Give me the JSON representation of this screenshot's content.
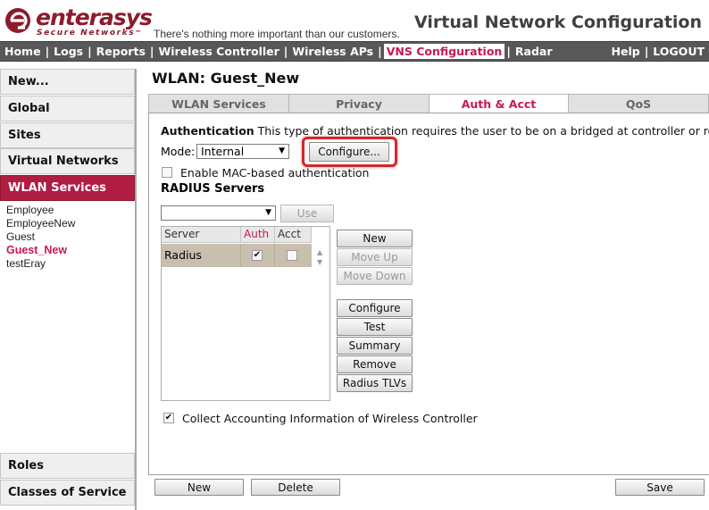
{
  "header": {
    "brand": "enterasys",
    "brand_sub": "Secure Networks",
    "brand_tm": "™",
    "tagline": "There's nothing more important than our customers.",
    "page_heading": "Virtual Network Configuration"
  },
  "nav": {
    "left": [
      "Home",
      "Logs",
      "Reports",
      "Wireless Controller",
      "Wireless APs",
      "VNS Configuration",
      "Radar"
    ],
    "active": "VNS Configuration",
    "help": "Help",
    "logout": "LOGOUT"
  },
  "sidebar": {
    "buttons": [
      "New...",
      "Global",
      "Sites",
      "Virtual Networks",
      "WLAN Services"
    ],
    "active_button": "WLAN Services",
    "wlan_list": [
      "Employee",
      "EmployeeNew",
      "Guest",
      "Guest_New",
      "testEray"
    ],
    "active_wlan": "Guest_New",
    "bottom_buttons": [
      "Roles",
      "Classes of Service"
    ]
  },
  "main": {
    "title": "WLAN: Guest_New",
    "tabs": [
      "WLAN Services",
      "Privacy",
      "Auth & Acct",
      "QoS"
    ],
    "active_tab": "Auth & Acct",
    "auth": {
      "heading": "Authentication",
      "description": " This type of authentication requires the user to be on a bridged at controller or routed",
      "mode_label": "Mode:",
      "mode_value": "Internal",
      "configure_label": "Configure...",
      "mac_auth_label": "Enable MAC-based authentication",
      "mac_auth_checked": false
    },
    "radius": {
      "title": "RADIUS Servers",
      "select_value": "",
      "use_label": "Use",
      "columns": [
        "Server",
        "Auth",
        "Acct"
      ],
      "rows": [
        {
          "server": "Radius",
          "auth": true,
          "acct": false
        }
      ],
      "side_buttons": [
        "New",
        "Move Up",
        "Move Down"
      ],
      "action_buttons": [
        "Configure",
        "Test",
        "Summary",
        "Remove",
        "Radius TLVs"
      ]
    },
    "accounting": {
      "label": "Collect Accounting Information of Wireless Controller",
      "checked": true
    },
    "footer": {
      "new_label": "New",
      "delete_label": "Delete",
      "save_label": "Save"
    }
  },
  "colors": {
    "brand": "#8d1b2c",
    "accent": "#c8175a",
    "nav_bg": "#585858",
    "active_sidebar": "#b01c42",
    "highlight": "#d4262c",
    "row_bg": "#c9bfae"
  },
  "icons": {
    "logo": "enterasys-e-logo-icon",
    "dropdown": "dropdown-arrow-icon",
    "check": "checkmark-icon",
    "scroll_up": "scroll-up-arrow-icon",
    "scroll_down": "scroll-down-arrow-icon"
  }
}
